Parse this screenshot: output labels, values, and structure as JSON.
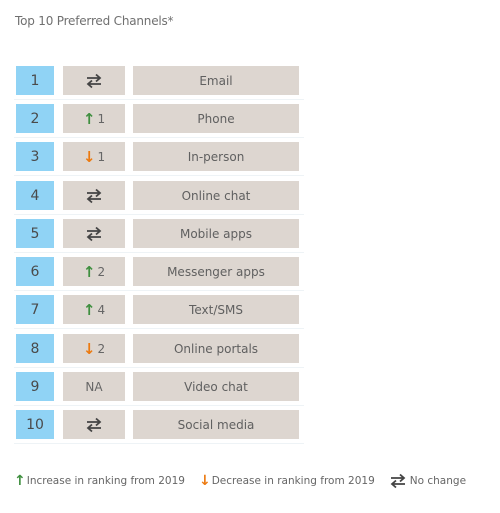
{
  "title": "Top 10 Preferred Channels*",
  "colors": {
    "rank_bg": "#90d3f5",
    "cell_bg": "#ddd6d0",
    "increase": "#3f8f3f",
    "decrease": "#ec7a10",
    "no_change": "#444444"
  },
  "rows": [
    {
      "rank": "1",
      "change_type": "no-change",
      "change_value": "",
      "channel": "Email"
    },
    {
      "rank": "2",
      "change_type": "increase",
      "change_value": "1",
      "channel": "Phone"
    },
    {
      "rank": "3",
      "change_type": "decrease",
      "change_value": "1",
      "channel": "In-person"
    },
    {
      "rank": "4",
      "change_type": "no-change",
      "change_value": "",
      "channel": "Online chat"
    },
    {
      "rank": "5",
      "change_type": "no-change",
      "change_value": "",
      "channel": "Mobile apps"
    },
    {
      "rank": "6",
      "change_type": "increase",
      "change_value": "2",
      "channel": "Messenger apps"
    },
    {
      "rank": "7",
      "change_type": "increase",
      "change_value": "4",
      "channel": "Text/SMS"
    },
    {
      "rank": "8",
      "change_type": "decrease",
      "change_value": "2",
      "channel": "Online portals"
    },
    {
      "rank": "9",
      "change_type": "na",
      "change_value": "NA",
      "channel": "Video chat"
    },
    {
      "rank": "10",
      "change_type": "no-change",
      "change_value": "",
      "channel": "Social media"
    }
  ],
  "legend": {
    "increase_label": "Increase in ranking from 2019",
    "decrease_label": "Decrease in ranking from 2019",
    "no_change_label": "No change"
  },
  "icons": {
    "increase": "arrow-up-icon",
    "decrease": "arrow-down-icon",
    "no_change": "swap-arrows-icon"
  }
}
